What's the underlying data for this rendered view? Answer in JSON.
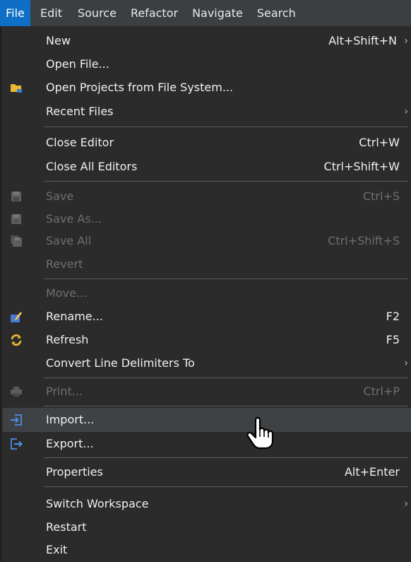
{
  "menubar": {
    "items": [
      "File",
      "Edit",
      "Source",
      "Refactor",
      "Navigate",
      "Search"
    ]
  },
  "menu": {
    "new": {
      "label": "New",
      "shortcut": "Alt+Shift+N"
    },
    "open_file": {
      "label": "Open File..."
    },
    "open_projects": {
      "label": "Open Projects from File System..."
    },
    "recent_files": {
      "label": "Recent Files"
    },
    "close_editor": {
      "label": "Close Editor",
      "shortcut": "Ctrl+W"
    },
    "close_all": {
      "label": "Close All Editors",
      "shortcut": "Ctrl+Shift+W"
    },
    "save": {
      "label": "Save",
      "shortcut": "Ctrl+S"
    },
    "save_as": {
      "label": "Save As..."
    },
    "save_all": {
      "label": "Save All",
      "shortcut": "Ctrl+Shift+S"
    },
    "revert": {
      "label": "Revert"
    },
    "move": {
      "label": "Move..."
    },
    "rename": {
      "label": "Rename...",
      "shortcut": "F2"
    },
    "refresh": {
      "label": "Refresh",
      "shortcut": "F5"
    },
    "convert": {
      "label": "Convert Line Delimiters To"
    },
    "print": {
      "label": "Print...",
      "shortcut": "Ctrl+P"
    },
    "import": {
      "label": "Import..."
    },
    "export": {
      "label": "Export..."
    },
    "properties": {
      "label": "Properties",
      "shortcut": "Alt+Enter"
    },
    "switch_workspace": {
      "label": "Switch Workspace"
    },
    "restart": {
      "label": "Restart"
    },
    "exit": {
      "label": "Exit"
    }
  },
  "colors": {
    "menu_bg": "#2b2b2b",
    "active_menu": "#0f6fc6",
    "hover_row": "#3f4244",
    "disabled_text": "#6f6f6f"
  },
  "icons": {
    "open_projects": "folder-icon",
    "save": "floppy-disk-icon",
    "rename": "rename-pencil-icon",
    "refresh": "refresh-icon",
    "print": "printer-icon",
    "import": "import-icon",
    "export": "export-icon"
  }
}
